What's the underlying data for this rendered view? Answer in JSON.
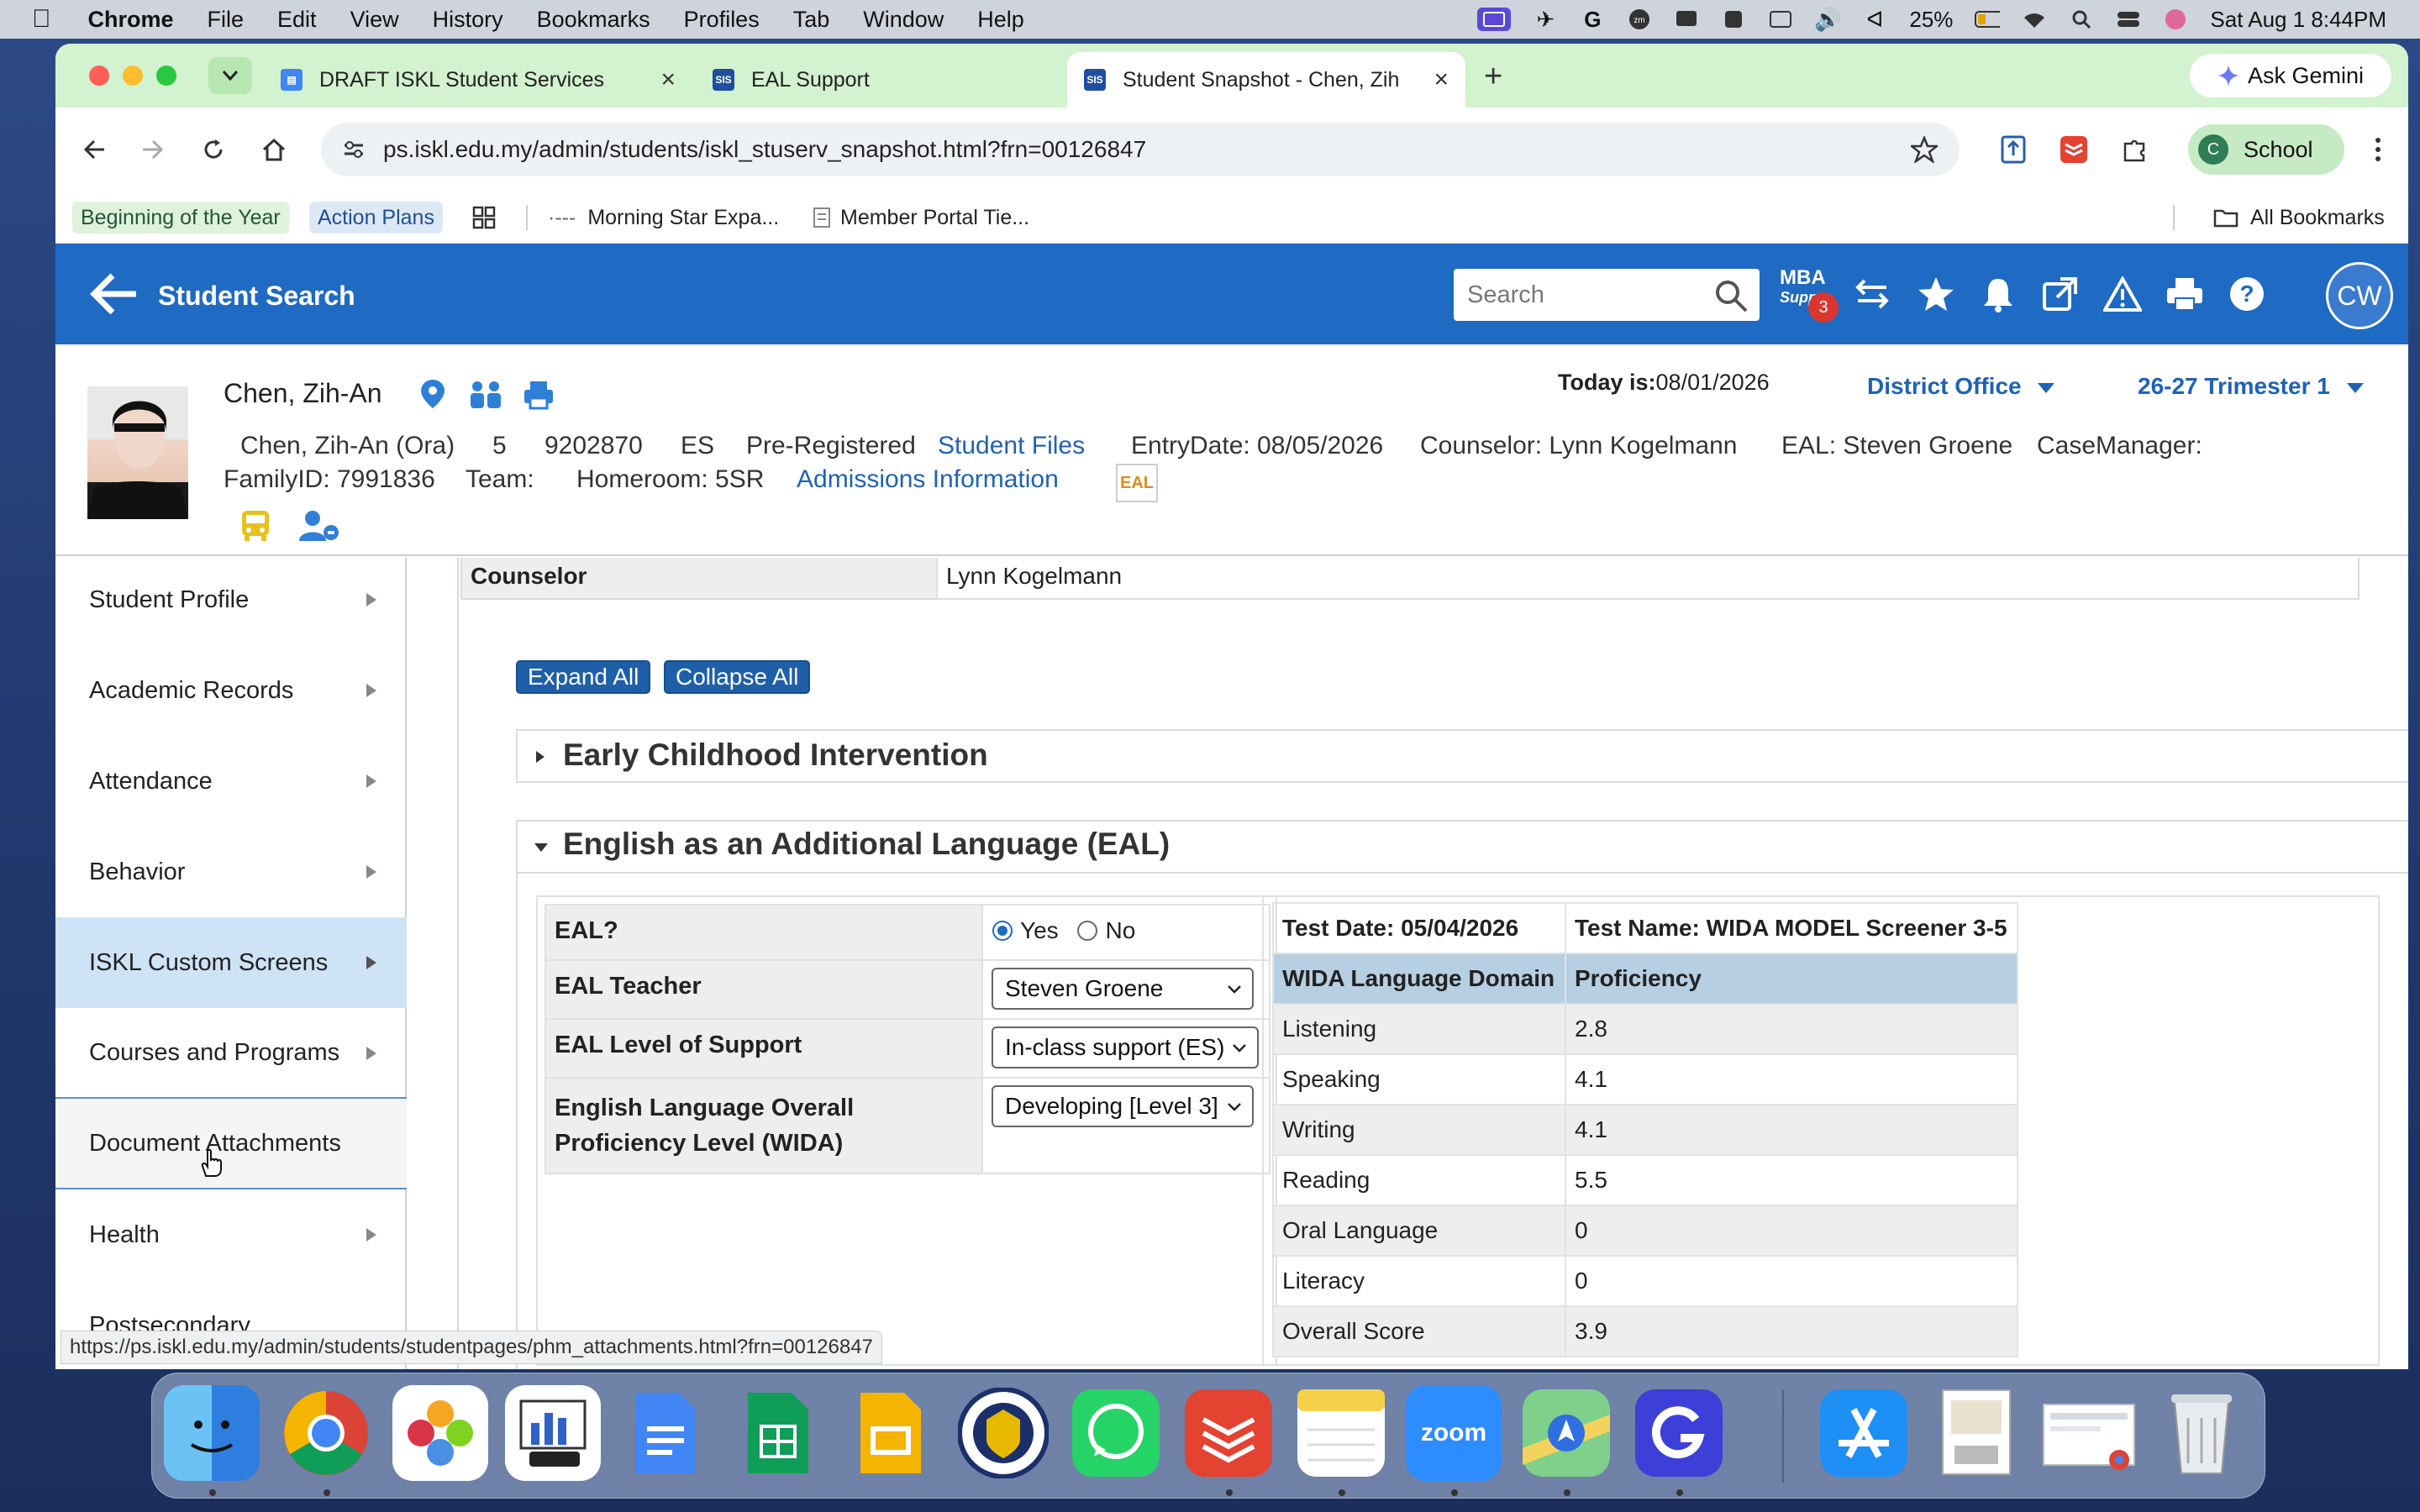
{
  "menubar": {
    "app": "Chrome",
    "items": [
      "File",
      "Edit",
      "View",
      "History",
      "Bookmarks",
      "Profiles",
      "Tab",
      "Window",
      "Help"
    ],
    "battery": "25%",
    "datetime": "Sat Aug 1  8:44PM"
  },
  "browser": {
    "tabs": [
      {
        "title": "DRAFT ISKL Student Services",
        "icon": "google-docs-icon",
        "color": "#4285f4"
      },
      {
        "title": "EAL Support",
        "icon": "sis-icon",
        "color": "#1f4fa0"
      },
      {
        "title": "Student Snapshot - Chen, Zih",
        "icon": "sis-icon",
        "color": "#1f4fa0"
      }
    ],
    "ask_gemini": "Ask Gemini",
    "url": "ps.iskl.edu.my/admin/students/iskl_stuserv_snapshot.html?frn=00126847",
    "profile_initial": "C",
    "profile_name": "School",
    "bookmarks": [
      "Beginning of the Year",
      "Action Plans",
      "Morning Star Expa...",
      "Member Portal Tie..."
    ],
    "all_bookmarks": "All Bookmarks"
  },
  "header": {
    "title": "Student Search",
    "search_placeholder": "Search",
    "mba_label": "MBA",
    "mba_sub": "Suppo",
    "mba_badge": "3",
    "user_initials": "CW",
    "accent_color": "#1f6ac2"
  },
  "student": {
    "name": "Chen, Zih-An",
    "full_name": "Chen, Zih-An (Ora)",
    "grade": "5",
    "student_number": "9202870",
    "school": "ES",
    "status": "Pre-Registered",
    "student_files": "Student Files",
    "entry_date": "EntryDate: 08/05/2026",
    "counselor": "Counselor: Lynn Kogelmann",
    "eal": "EAL: Steven Groene",
    "case_manager": "CaseManager:",
    "family_id": "FamilyID: 7991836",
    "team": "Team:",
    "homeroom": "Homeroom: 5SR",
    "admissions": "Admissions Information",
    "eal_badge": "EAL",
    "today_label": "Today is:",
    "today_value": "08/01/2026",
    "district": "District Office",
    "term": "26-27 Trimester 1"
  },
  "sidebar": {
    "items": [
      {
        "label": "Student Profile",
        "arrow": true
      },
      {
        "label": "Academic Records",
        "arrow": true
      },
      {
        "label": "Attendance",
        "arrow": true
      },
      {
        "label": "Behavior",
        "arrow": true
      },
      {
        "label": "ISKL Custom Screens",
        "arrow": true,
        "selected": true
      },
      {
        "label": "Courses and Programs",
        "arrow": true
      },
      {
        "label": "Document Attachments",
        "arrow": false
      },
      {
        "label": "Health",
        "arrow": true
      },
      {
        "label": "Postsecondary",
        "arrow": false
      }
    ]
  },
  "main": {
    "counselor_label": "Counselor",
    "counselor_value": "Lynn Kogelmann",
    "expand_all": "Expand All",
    "collapse_all": "Collapse All",
    "section1": "Early Childhood Intervention",
    "section2": "English as an Additional Language (EAL)",
    "eal_form": {
      "eal_q": "EAL?",
      "yes": "Yes",
      "no": "No",
      "selected": "Yes",
      "teacher_label": "EAL Teacher",
      "teacher_value": "Steven Groene",
      "support_label": "EAL Level of Support",
      "support_value": "In-class support (ES)",
      "prof_label_1": "English Language Overall",
      "prof_label_2": "Proficiency Level (WIDA)",
      "prof_value": "Developing [Level 3]"
    },
    "wida": {
      "test_date": "Test Date: 05/04/2026",
      "test_name": "Test Name: WIDA MODEL Screener 3-5",
      "col1": "WIDA Language Domain",
      "col2": "Proficiency",
      "rows": [
        {
          "domain": "Listening",
          "score": "2.8"
        },
        {
          "domain": "Speaking",
          "score": "4.1"
        },
        {
          "domain": "Writing",
          "score": "4.1"
        },
        {
          "domain": "Reading",
          "score": "5.5"
        },
        {
          "domain": "Oral Language",
          "score": "0"
        },
        {
          "domain": "Literacy",
          "score": "0"
        },
        {
          "domain": "Overall Score",
          "score": "3.9"
        }
      ]
    }
  },
  "status_url": "https://ps.iskl.edu.my/admin/students/studentpages/phm_attachments.html?frn=00126847",
  "dock": {
    "apps": [
      "finder-icon",
      "chrome-icon",
      "photos-icon",
      "keynote-icon",
      "google-docs-icon",
      "google-sheets-icon",
      "google-slides-icon",
      "iskl-crest-icon",
      "whatsapp-icon",
      "todoist-icon",
      "notes-icon",
      "zoom-icon",
      "maps-icon",
      "grammarly-icon",
      "app-store-icon",
      "pdf-document-icon",
      "screenshot-icon",
      "trash-icon"
    ],
    "zoom_label": "zoom"
  }
}
